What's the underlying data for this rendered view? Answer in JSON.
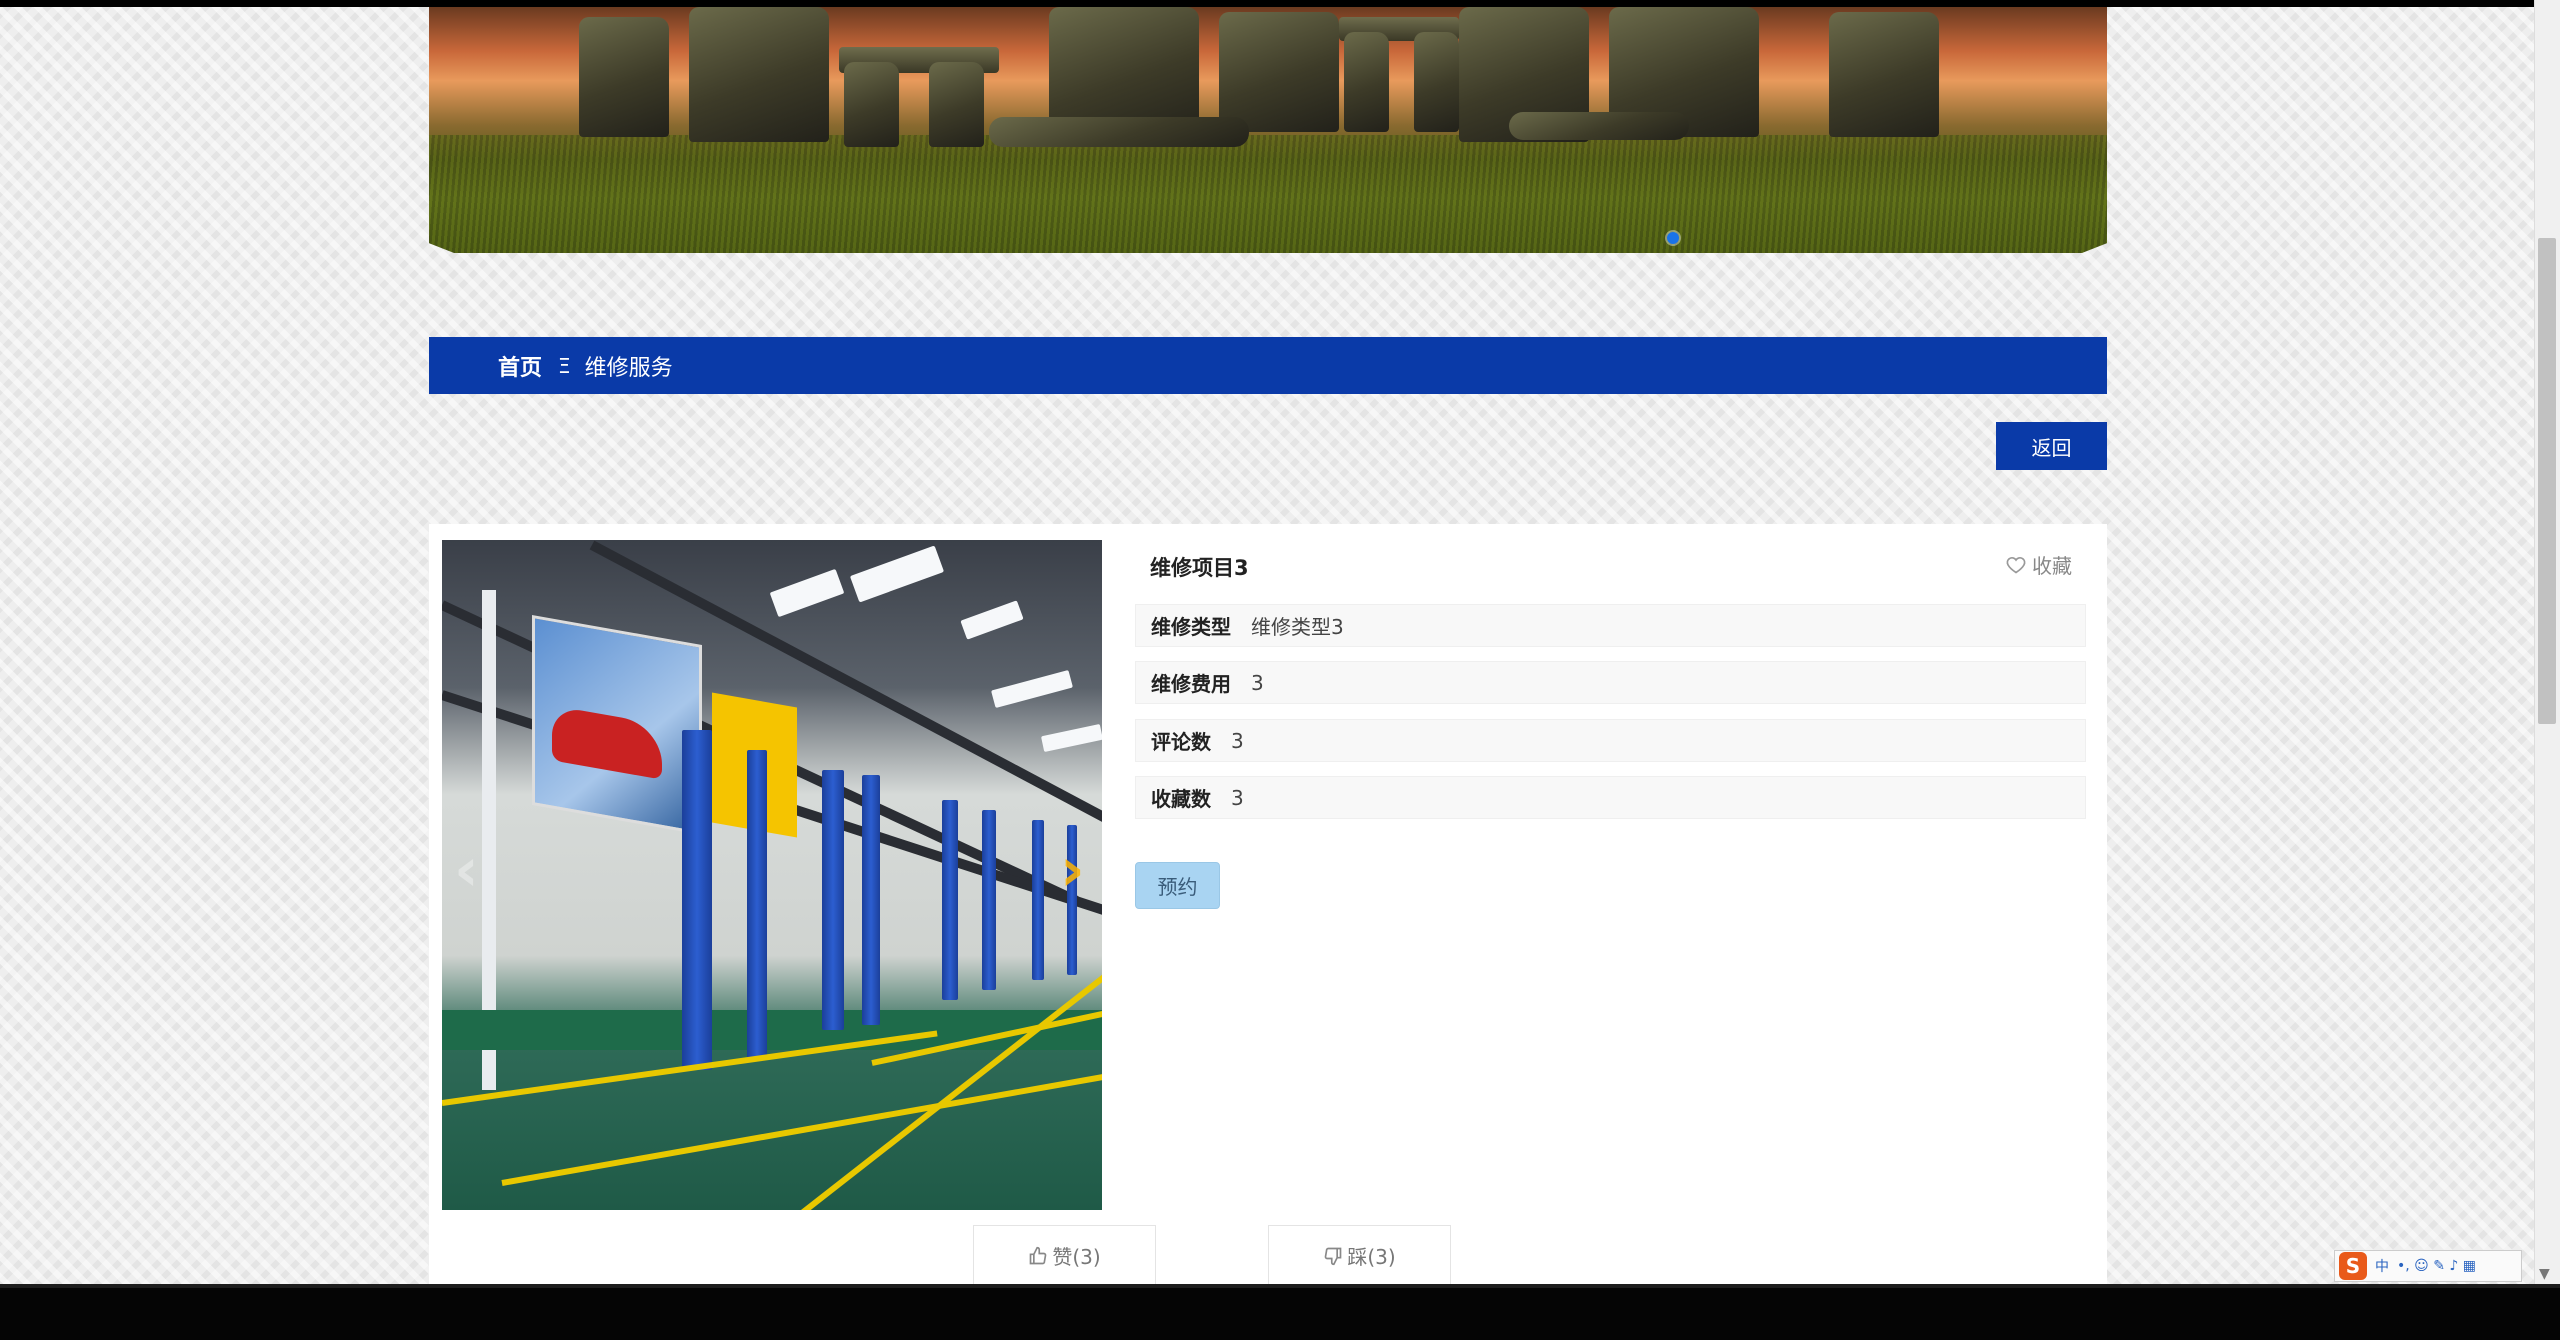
{
  "breadcrumb": {
    "home": "首页",
    "separator": "Ξ",
    "current": "维修服务"
  },
  "back_label": "返回",
  "item": {
    "title": "维修项目3",
    "favorite_label": "收藏",
    "rows": [
      {
        "label": "维修类型",
        "value": "维修类型3"
      },
      {
        "label": "维修费用",
        "value": "3"
      },
      {
        "label": "评论数",
        "value": "3"
      },
      {
        "label": "收藏数",
        "value": "3"
      }
    ],
    "reserve_label": "预约"
  },
  "votes": {
    "like_label": "赞(3)",
    "dislike_label": "踩(3)"
  },
  "ime": {
    "lang": "中",
    "symbols": "•,  ☺  ✎  ♪  ▦"
  },
  "colors": {
    "primary": "#0a3aa8",
    "reserve": "#a9d4f2"
  }
}
